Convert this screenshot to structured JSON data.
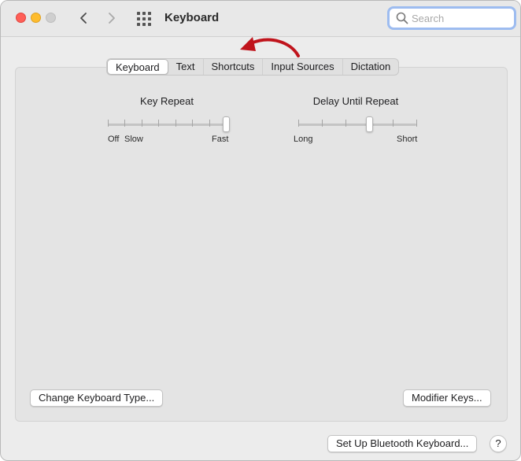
{
  "window": {
    "title": "Keyboard"
  },
  "search": {
    "placeholder": "Search"
  },
  "tabs": [
    {
      "label": "Keyboard",
      "active": true
    },
    {
      "label": "Text",
      "active": false
    },
    {
      "label": "Shortcuts",
      "active": false
    },
    {
      "label": "Input Sources",
      "active": false
    },
    {
      "label": "Dictation",
      "active": false
    }
  ],
  "annotation": {
    "arrow_color": "#c0141c",
    "points_to": "Shortcuts"
  },
  "key_repeat": {
    "title": "Key Repeat",
    "labels": {
      "off": "Off",
      "slow": "Slow",
      "fast": "Fast"
    },
    "steps": 8,
    "value_step": 7
  },
  "delay_until_repeat": {
    "title": "Delay Until Repeat",
    "labels": {
      "long": "Long",
      "short": "Short"
    },
    "steps": 6,
    "value_step": 3
  },
  "buttons": {
    "change_type": "Change Keyboard Type...",
    "modifier_keys": "Modifier Keys...",
    "bluetooth": "Set Up Bluetooth Keyboard...",
    "help": "?"
  },
  "colors": {
    "close": "#ff5f57",
    "minimize": "#febc2e",
    "zoom": "#cfcfcf",
    "search_focus": "#9dbcf0"
  },
  "icons": [
    "back-chevron-icon",
    "forward-chevron-icon",
    "grid-icon",
    "search-icon"
  ]
}
